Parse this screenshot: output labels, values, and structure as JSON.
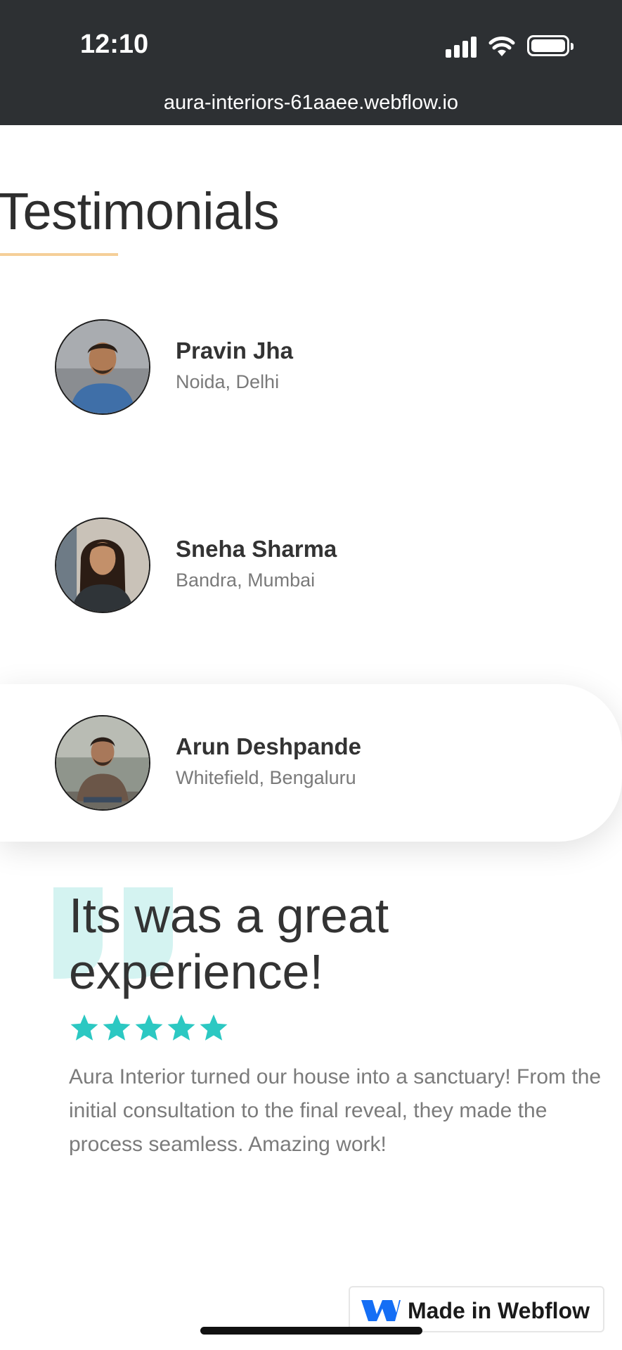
{
  "status_bar": {
    "time": "12:10"
  },
  "browser": {
    "url": "aura-interiors-61aaee.webflow.io"
  },
  "section": {
    "title": "Testimonials"
  },
  "testimonials": [
    {
      "name": "Pravin Jha",
      "location": "Noida, Delhi"
    },
    {
      "name": "Sneha Sharma",
      "location": "Bandra, Mumbai"
    },
    {
      "name": "Arun Deshpande",
      "location": "Whitefield, Bengaluru"
    }
  ],
  "active_testimonial": {
    "title": "Its was a great experience!",
    "rating": 5,
    "body": "Aura Interior turned our house into a sanctuary! From the initial consultation to the final reveal, they made the process seamless. Amazing work!"
  },
  "badge": {
    "label": "Made in Webflow"
  },
  "colors": {
    "topbar": "#2d3033",
    "accent_rule": "#f5cf98",
    "star": "#2cc8c2",
    "quote_mark": "#d4f3f1"
  }
}
